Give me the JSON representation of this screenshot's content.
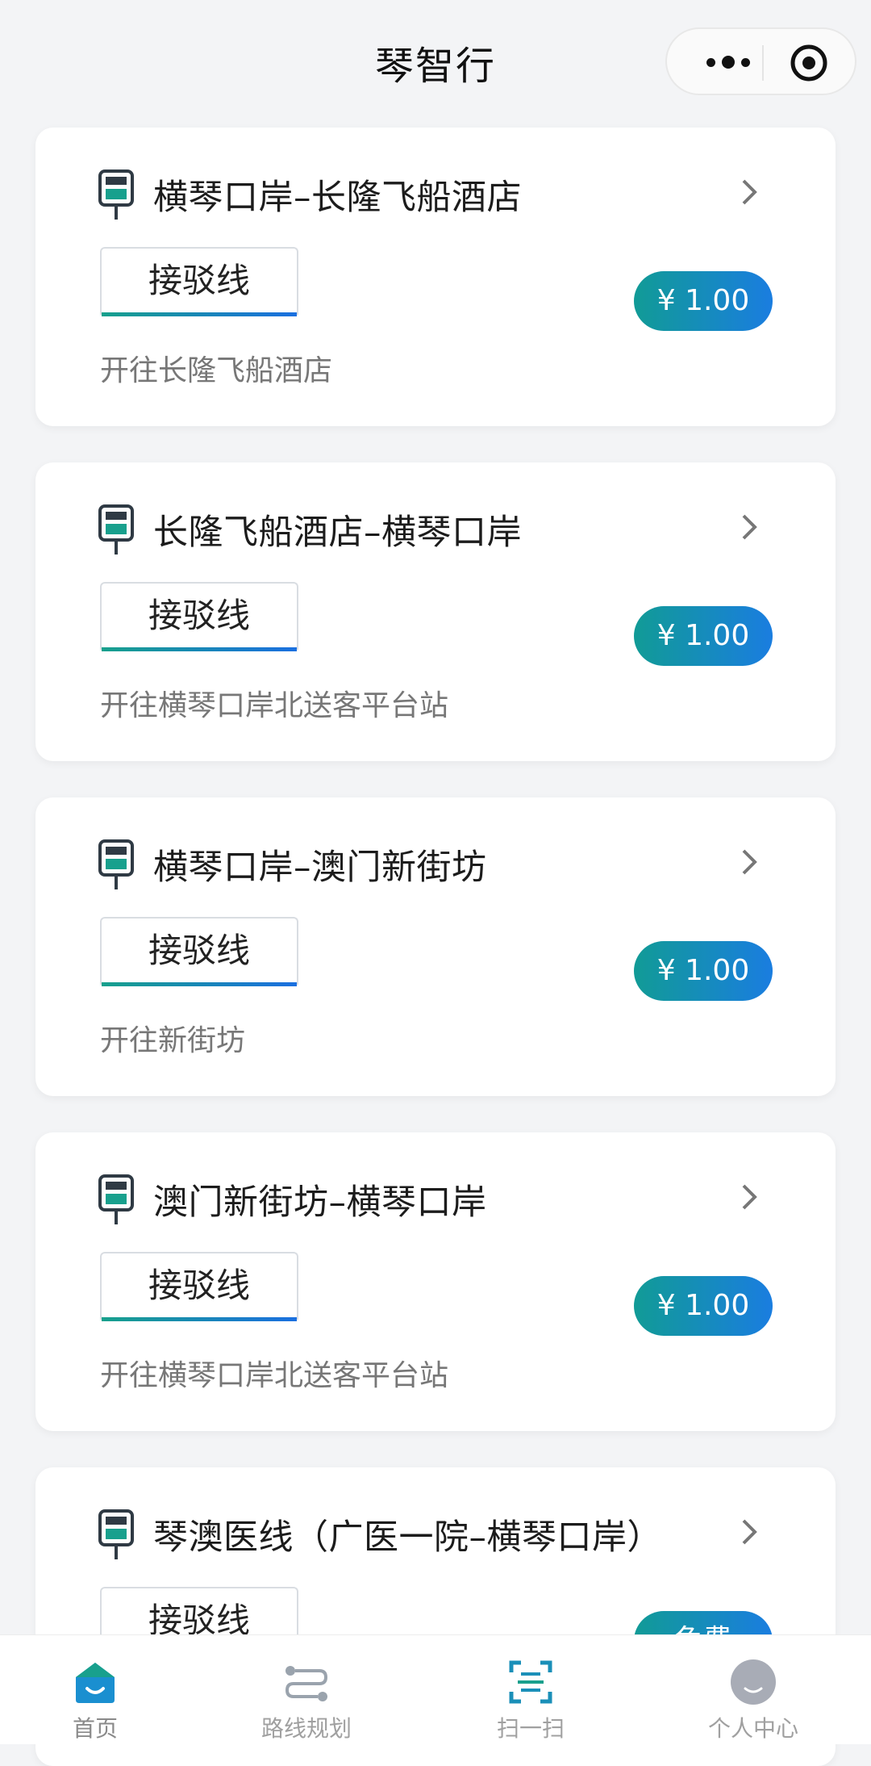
{
  "header": {
    "title": "琴智行"
  },
  "routes": [
    {
      "name": "横琴口岸–长隆飞船酒店",
      "tag": "接驳线",
      "destination": "开往长隆飞船酒店",
      "price": "¥ 1.00"
    },
    {
      "name": "长隆飞船酒店–横琴口岸",
      "tag": "接驳线",
      "destination": "开往横琴口岸北送客平台站",
      "price": "¥ 1.00"
    },
    {
      "name": "横琴口岸–澳门新街坊",
      "tag": "接驳线",
      "destination": "开往新街坊",
      "price": "¥ 1.00"
    },
    {
      "name": "澳门新街坊–横琴口岸",
      "tag": "接驳线",
      "destination": "开往横琴口岸北送客平台站",
      "price": "¥ 1.00"
    },
    {
      "name": "琴澳医线（广医一院–横琴口岸）",
      "tag": "接驳线",
      "destination": "",
      "price": "免费"
    }
  ],
  "tabbar": {
    "items": [
      {
        "label": "首页",
        "icon": "home-icon",
        "active": true
      },
      {
        "label": "路线规划",
        "icon": "route-icon"
      },
      {
        "label": "扫一扫",
        "icon": "scan-icon"
      },
      {
        "label": "个人中心",
        "icon": "avatar-icon"
      }
    ]
  },
  "colors": {
    "accent_start": "#119b96",
    "accent_end": "#1a7de0",
    "icon_dark": "#2f3a44"
  }
}
